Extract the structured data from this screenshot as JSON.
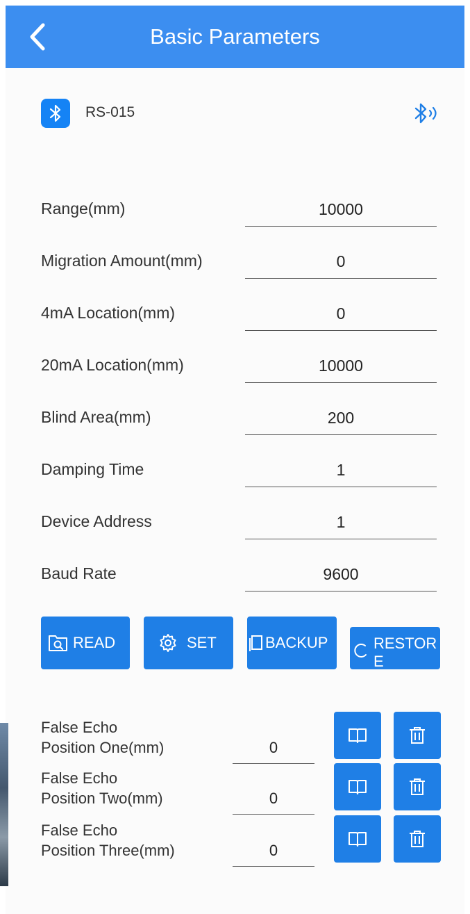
{
  "header": {
    "title": "Basic Parameters"
  },
  "device": {
    "name": "RS-015"
  },
  "parameters": [
    {
      "label": "Range(mm)",
      "value": "10000"
    },
    {
      "label": "Migration Amount(mm)",
      "value": "0"
    },
    {
      "label": "4mA Location(mm)",
      "value": "0"
    },
    {
      "label": "20mA Location(mm)",
      "value": "10000"
    },
    {
      "label": "Blind Area(mm)",
      "value": "200"
    },
    {
      "label": "Damping Time",
      "value": "1"
    },
    {
      "label": "Device Address",
      "value": "1"
    },
    {
      "label": "Baud Rate",
      "value": "9600"
    }
  ],
  "actions": {
    "read": "READ",
    "set": "SET",
    "backup": "BACKUP",
    "restore": "RESTORE"
  },
  "false_echo": [
    {
      "line1": "False Echo",
      "line2": "Position One(mm)",
      "value": "0"
    },
    {
      "line1": "False Echo",
      "line2": "Position Two(mm)",
      "value": "0"
    },
    {
      "line1": "False Echo",
      "line2": "Position Three(mm)",
      "value": "0"
    }
  ],
  "icons": {
    "back": "chevron-left-icon",
    "bluetooth": "bluetooth-icon",
    "bluetooth_connected": "bluetooth-connected-icon",
    "read": "folder-search-icon",
    "set": "gear-icon",
    "backup": "copy-icon",
    "restore": "refresh-icon",
    "book": "book-icon",
    "delete": "trash-icon"
  },
  "colors": {
    "header": "#3c8ef0",
    "button": "#1f7fe6",
    "bluetooth_badge": "#1583f5"
  }
}
